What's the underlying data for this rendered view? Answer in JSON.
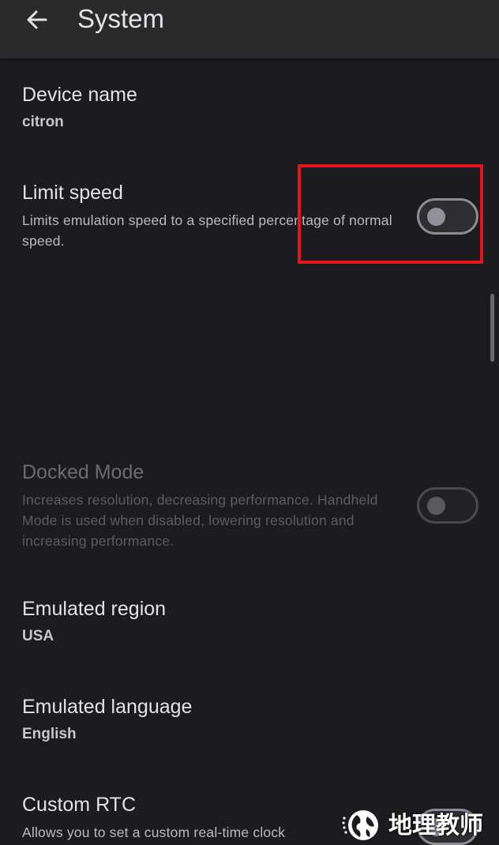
{
  "app_bar": {
    "title": "System",
    "back_icon": "arrow-back-icon"
  },
  "settings": [
    {
      "title": "Device name",
      "value": "citron"
    },
    {
      "title": "Limit speed",
      "description": "Limits emulation speed to a specified percentage of normal speed.",
      "toggle_on": false
    },
    {
      "title": "Docked Mode",
      "description": "Increases resolution, decreasing performance. Handheld Mode is used when disabled, lowering resolution and increasing performance.",
      "toggle_on": false,
      "enabled": false
    },
    {
      "title": "Emulated region",
      "value": "USA"
    },
    {
      "title": "Emulated language",
      "value": "English"
    },
    {
      "title": "Custom RTC",
      "description": "Allows you to set a custom real-time clock",
      "toggle_on": false
    }
  ],
  "watermark": {
    "text": "地理教师",
    "icon": "globe-icon"
  },
  "colors": {
    "background": "#1c1b1f",
    "app_bar": "#2a2a2d",
    "highlight": "#e8141c",
    "toggle_outline": "#8f8a96"
  }
}
